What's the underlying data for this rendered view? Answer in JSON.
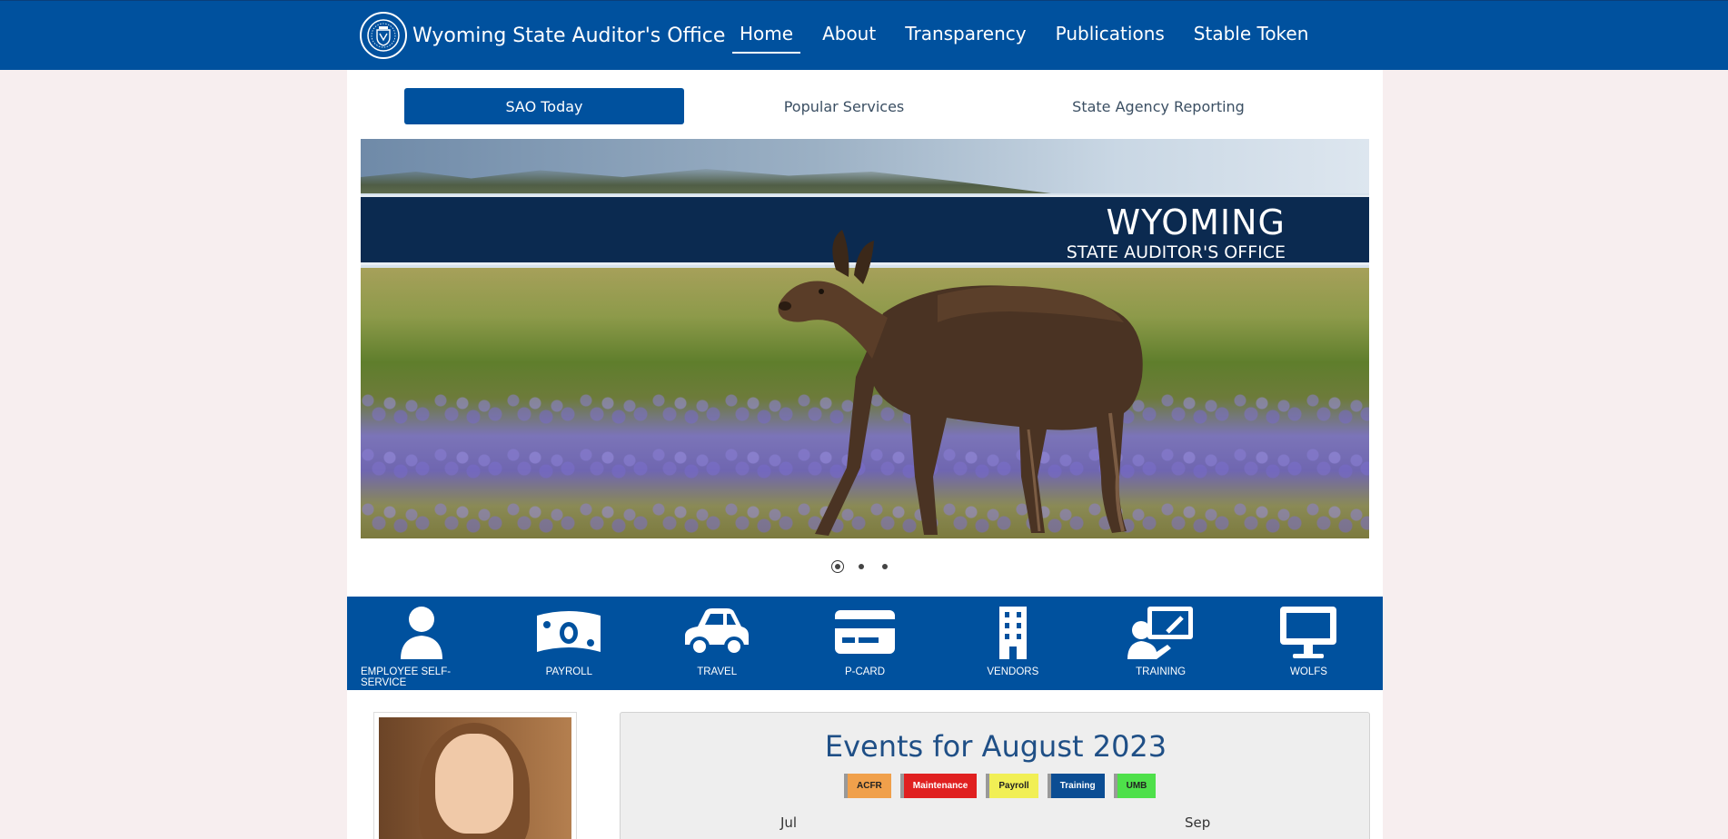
{
  "header": {
    "brand_title": "Wyoming State Auditor's Office",
    "nav": [
      {
        "label": "Home",
        "active": true
      },
      {
        "label": "About"
      },
      {
        "label": "Transparency"
      },
      {
        "label": "Publications"
      },
      {
        "label": "Stable Token"
      }
    ]
  },
  "tabs": [
    {
      "label": "SAO Today",
      "active": true
    },
    {
      "label": "Popular Services"
    },
    {
      "label": "State Agency Reporting"
    }
  ],
  "hero": {
    "title": "WYOMING",
    "subtitle": "STATE AUDITOR'S OFFICE",
    "slide_count": 3,
    "active_slide": 1
  },
  "services": [
    {
      "label": "EMPLOYEE SELF-SERVICE",
      "icon": "user-icon"
    },
    {
      "label": "PAYROLL",
      "icon": "money-icon"
    },
    {
      "label": "TRAVEL",
      "icon": "car-icon"
    },
    {
      "label": "P-CARD",
      "icon": "credit-card-icon"
    },
    {
      "label": "VENDORS",
      "icon": "building-icon"
    },
    {
      "label": "TRAINING",
      "icon": "presentation-icon"
    },
    {
      "label": "WOLFS",
      "icon": "monitor-icon"
    }
  ],
  "events": {
    "title": "Events for August 2023",
    "legend": [
      {
        "label": "ACFR",
        "bg": "#f0a04b",
        "color": "#222"
      },
      {
        "label": "Maintenance",
        "bg": "#e02020",
        "color": "#fff"
      },
      {
        "label": "Payroll",
        "bg": "#f1ef55",
        "color": "#222"
      },
      {
        "label": "Training",
        "bg": "#0b4d93",
        "color": "#fff"
      },
      {
        "label": "UMB",
        "bg": "#4ee04a",
        "color": "#222"
      }
    ],
    "prev_month": "Jul",
    "next_month": "Sep"
  },
  "colors": {
    "brand_blue": "#00519e",
    "page_bg": "#f7eeef"
  }
}
